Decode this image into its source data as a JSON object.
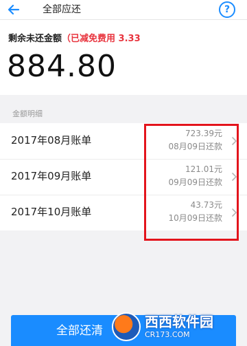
{
  "header": {
    "title": "全部应还",
    "help_label": "?"
  },
  "summary": {
    "label": "剩余未还金额",
    "paren_open": "（",
    "discount_note": "已减免费用 3.33",
    "amount": "884.80"
  },
  "section": {
    "label": "金额明细"
  },
  "bills": [
    {
      "label": "2017年08月账单",
      "amount": "723.39元",
      "due": "08月09日还款"
    },
    {
      "label": "2017年09月账单",
      "amount": "121.01元",
      "due": "09月09日还款"
    },
    {
      "label": "2017年10月账单",
      "amount": "43.73元",
      "due": "10月09日还款"
    }
  ],
  "footer": {
    "button_label": "全部还清"
  },
  "watermark": {
    "name": "西西软件园",
    "url": "CR173.COM"
  },
  "colors": {
    "accent": "#1a8cff",
    "discount": "#e8343e",
    "highlight": "#e3141c"
  },
  "icons": {
    "back": "arrow-left-icon",
    "help": "question-circle-icon",
    "row": "chevron-right-icon"
  }
}
